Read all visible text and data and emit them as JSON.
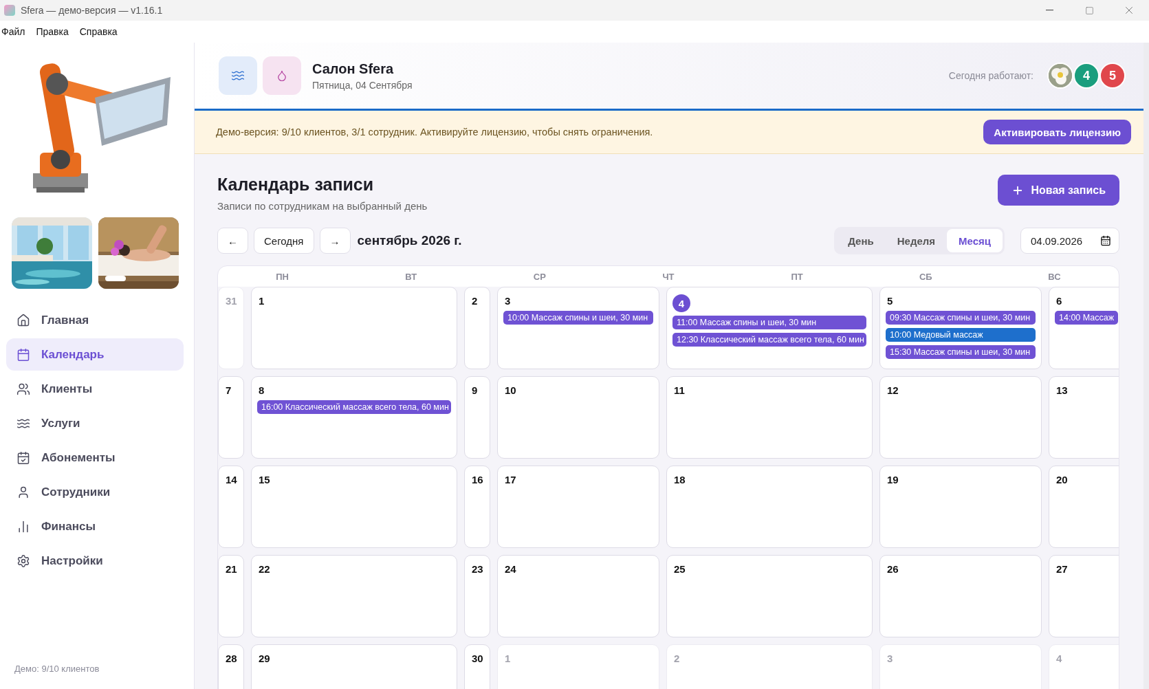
{
  "window": {
    "title": "Sfera — демо-версия — v1.16.1"
  },
  "menu": [
    "Файл",
    "Правка",
    "Справка"
  ],
  "sidebar": {
    "items": [
      {
        "label": "Главная",
        "selected": false
      },
      {
        "label": "Календарь",
        "selected": true
      },
      {
        "label": "Клиенты",
        "selected": false
      },
      {
        "label": "Услуги",
        "selected": false
      },
      {
        "label": "Абонементы",
        "selected": false
      },
      {
        "label": "Сотрудники",
        "selected": false
      },
      {
        "label": "Финансы",
        "selected": false
      },
      {
        "label": "Настройки",
        "selected": false
      }
    ],
    "footer": "Демо: 9/10 клиентов"
  },
  "header": {
    "title": "Салон Sfera",
    "date": "Пятница, 04 Сентября",
    "staff_label": "Сегодня работают:",
    "staff": [
      {
        "kind": "picture"
      },
      {
        "kind": "initial",
        "text": "4",
        "color": "#1a9e7e"
      },
      {
        "kind": "initial",
        "text": "5",
        "color": "#e0474c"
      }
    ]
  },
  "banner": {
    "text": "Демо-версия: 9/10 клиентов, 3/1 сотрудник. Активируйте лицензию, чтобы снять ограничения.",
    "button": "Активировать лицензию"
  },
  "page": {
    "title": "Календарь записи",
    "subtitle": "Записи по сотрудникам на выбранный день",
    "new_button": "Новая запись"
  },
  "toolbar": {
    "prev": "←",
    "today": "Сегодня",
    "next": "→",
    "month": "сентябрь 2026 г.",
    "views": [
      {
        "label": "День",
        "selected": false
      },
      {
        "label": "Неделя",
        "selected": false
      },
      {
        "label": "Месяц",
        "selected": true
      }
    ],
    "date": "04.09.2026"
  },
  "calendar": {
    "weekdays": [
      "ПН",
      "ВТ",
      "СР",
      "ЧТ",
      "ПТ",
      "СБ",
      "ВС"
    ],
    "weeks": [
      {
        "days": [
          {
            "label": "31",
            "current_month": false,
            "today": false
          },
          {
            "label": "1",
            "current_month": true,
            "today": false
          },
          {
            "label": "2",
            "current_month": true,
            "today": false
          },
          {
            "label": "3",
            "current_month": true,
            "today": false,
            "events": [
              {
                "text": "10:00 Массаж спины и шеи, 30 мин",
                "color": "#6f52d4"
              }
            ]
          },
          {
            "label": "4",
            "current_month": true,
            "today": true,
            "events": [
              {
                "text": "11:00 Массаж спины и шеи, 30 мин",
                "color": "#6f52d4"
              },
              {
                "text": "12:30 Классический массаж всего тела, 60 мин",
                "color": "#6f52d4"
              }
            ]
          },
          {
            "label": "5",
            "current_month": true,
            "today": false,
            "events": [
              {
                "text": "09:30 Массаж спины и шеи, 30 мин",
                "color": "#6f52d4"
              },
              {
                "text": "10:00 Медовый массаж",
                "color": "#1e6fcc"
              },
              {
                "text": "15:30 Массаж спины и шеи, 30 мин",
                "color": "#6f52d4"
              }
            ]
          },
          {
            "label": "6",
            "current_month": true,
            "today": false,
            "events": [
              {
                "text": "14:00 Массаж",
                "color": "#6f52d4"
              }
            ]
          }
        ]
      },
      {
        "days": [
          {
            "label": "7",
            "current_month": true,
            "today": false
          },
          {
            "label": "8",
            "current_month": true,
            "today": false,
            "events": [
              {
                "text": "16:00 Классический массаж всего тела, 60 мин",
                "color": "#6f52d4"
              }
            ]
          },
          {
            "label": "9",
            "current_month": true,
            "today": false
          },
          {
            "label": "10",
            "current_month": true,
            "today": false
          },
          {
            "label": "11",
            "current_month": true,
            "today": false
          },
          {
            "label": "12",
            "current_month": true,
            "today": false
          },
          {
            "label": "13",
            "current_month": true,
            "today": false
          }
        ]
      },
      {
        "days": [
          {
            "label": "14",
            "current_month": true,
            "today": false
          },
          {
            "label": "15",
            "current_month": true,
            "today": false
          },
          {
            "label": "16",
            "current_month": true,
            "today": false
          },
          {
            "label": "17",
            "current_month": true,
            "today": false
          },
          {
            "label": "18",
            "current_month": true,
            "today": false
          },
          {
            "label": "19",
            "current_month": true,
            "today": false
          },
          {
            "label": "20",
            "current_month": true,
            "today": false
          }
        ]
      },
      {
        "days": [
          {
            "label": "21",
            "current_month": true,
            "today": false
          },
          {
            "label": "22",
            "current_month": true,
            "today": false
          },
          {
            "label": "23",
            "current_month": true,
            "today": false
          },
          {
            "label": "24",
            "current_month": true,
            "today": false
          },
          {
            "label": "25",
            "current_month": true,
            "today": false
          },
          {
            "label": "26",
            "current_month": true,
            "today": false
          },
          {
            "label": "27",
            "current_month": true,
            "today": false
          }
        ]
      },
      {
        "days": [
          {
            "label": "28",
            "current_month": true,
            "today": false
          },
          {
            "label": "29",
            "current_month": true,
            "today": false
          },
          {
            "label": "30",
            "current_month": true,
            "today": false
          },
          {
            "label": "1",
            "current_month": false,
            "today": false
          },
          {
            "label": "2",
            "current_month": false,
            "today": false
          },
          {
            "label": "3",
            "current_month": false,
            "today": false
          },
          {
            "label": "4",
            "current_month": false,
            "today": false
          }
        ]
      }
    ]
  }
}
